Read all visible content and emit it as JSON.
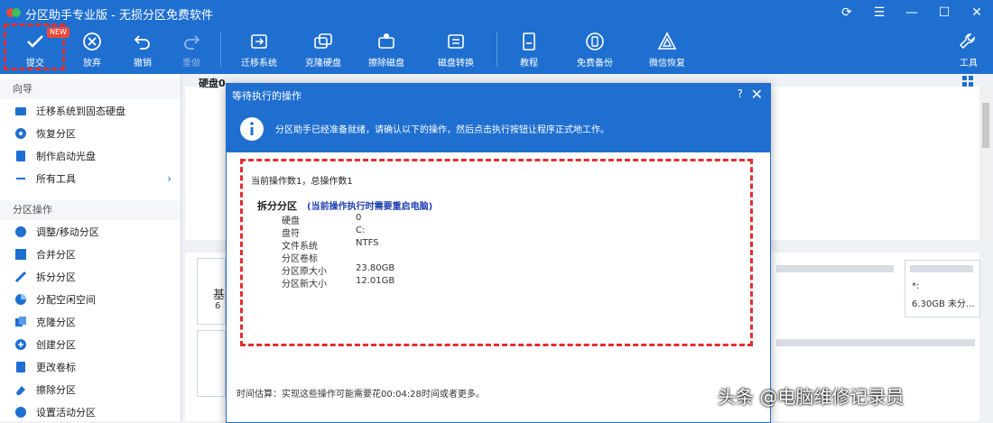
{
  "titlebar": {
    "title": "分区助手专业版 - 无损分区免费软件"
  },
  "toolbar": {
    "commit": "提交",
    "commit_badge": "NEW",
    "discard": "放弃",
    "undo": "撤销",
    "redo": "重做",
    "migrate": "迁移系统",
    "clone": "克隆硬盘",
    "wipe": "擦除磁盘",
    "convert": "磁盘转换",
    "tutorial": "教程",
    "backup": "免费备份",
    "wechat": "微信恢复",
    "tools": "工具"
  },
  "sidebar": {
    "section_wizard": "向导",
    "wizard_items": [
      "迁移系统到固态硬盘",
      "恢复分区",
      "制作启动光盘",
      "所有工具"
    ],
    "section_ops": "分区操作",
    "ops_items": [
      "调整/移动分区",
      "合并分区",
      "拆分分区",
      "分配空闲空间",
      "克隆分区",
      "创建分区",
      "更改卷标",
      "擦除分区",
      "设置活动分区"
    ]
  },
  "main": {
    "disk_label": "硬盘0",
    "right_free": "6.30GB 未分...",
    "right_star": "*:",
    "left_char_1": "基",
    "left_char_2": "6"
  },
  "dialog": {
    "title": "等待执行的操作",
    "help": "?",
    "banner": "分区助手已经准备就绪，请确认以下的操作，然后点击执行按钮让程序正式地工作。",
    "op_count": "当前操作数1，总操作数1",
    "op_name": "拆分分区",
    "op_note": "(当前操作执行时需要重启电脑)",
    "details": [
      {
        "label": "硬盘",
        "value": "0"
      },
      {
        "label": "盘符",
        "value": "C:"
      },
      {
        "label": "文件系统",
        "value": "NTFS"
      },
      {
        "label": "分区卷标",
        "value": ""
      },
      {
        "label": "分区原大小",
        "value": "23.80GB"
      },
      {
        "label": "分区新大小",
        "value": "12.01GB"
      }
    ],
    "time_estimate": "时间估算：实现这些操作可能需要花00:04:28时间或者更多。"
  },
  "watermark": "头条 @电脑维修记录员",
  "colors": {
    "brand": "#1f6fd0",
    "highlight": "#e03030",
    "note": "#1f3fb0"
  }
}
